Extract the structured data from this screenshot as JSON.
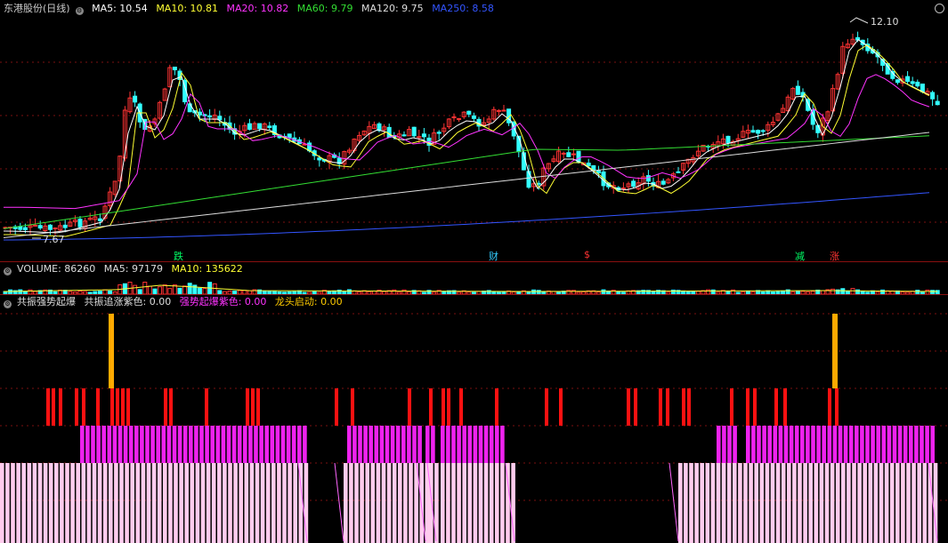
{
  "main": {
    "title": "东港股份(日线)",
    "ma": [
      {
        "label": "MA5: 10.54",
        "color": "#ffffff"
      },
      {
        "label": "MA10: 10.81",
        "color": "#ffff33"
      },
      {
        "label": "MA20: 10.82",
        "color": "#ff33ff"
      },
      {
        "label": "MA60: 9.79",
        "color": "#33dd33"
      },
      {
        "label": "MA120: 9.75",
        "color": "#dddddd"
      },
      {
        "label": "MA250: 8.58",
        "color": "#3355ff"
      }
    ],
    "high_label": "12.10",
    "low_label": "7.67",
    "badges": [
      {
        "text": "跌",
        "color": "#00ff66"
      },
      {
        "text": "财",
        "color": "#33ccff"
      },
      {
        "text": "$",
        "color": "#ff3333"
      },
      {
        "text": "减",
        "color": "#00ff66"
      },
      {
        "text": "涨",
        "color": "#ff3333"
      }
    ]
  },
  "volume": {
    "labels": [
      {
        "text": "VOLUME: 86260",
        "color": "#dddddd"
      },
      {
        "text": "MA5: 97179",
        "color": "#dddddd"
      },
      {
        "text": "MA10: 135622",
        "color": "#ffff33"
      }
    ]
  },
  "indicator": {
    "labels": [
      {
        "text": "共振强势起爆",
        "color": "#dddddd"
      },
      {
        "text": "共振追涨紫色: 0.00",
        "color": "#dddddd"
      },
      {
        "text": "强势起爆紫色: 0.00",
        "color": "#ff33ff"
      },
      {
        "text": "龙头启动: 0.00",
        "color": "#ffcc00"
      }
    ]
  },
  "colors": {
    "up": "#ff3333",
    "down": "#33ffff",
    "grid": "#7a1010",
    "pink": "#ffccee",
    "magenta": "#ee22ee",
    "red": "#ff1111",
    "gold": "#ffaa00"
  }
}
